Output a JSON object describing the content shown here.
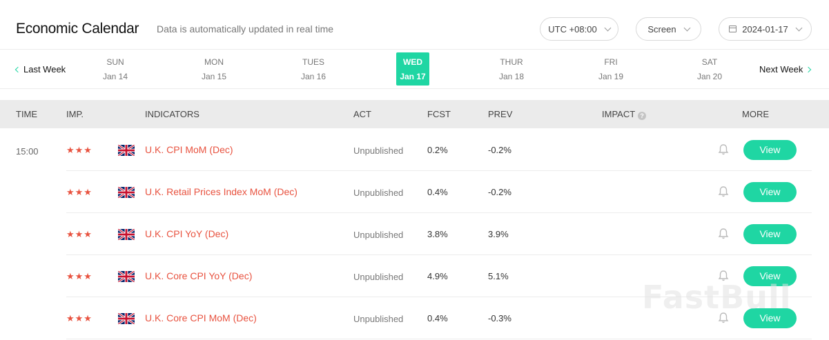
{
  "header": {
    "title": "Economic Calendar",
    "subtitle": "Data is automatically updated in real time",
    "timezone_label": "UTC +08:00",
    "view_label": "Screen",
    "date_label": "2024-01-17"
  },
  "week": {
    "prev_label": "Last Week",
    "next_label": "Next Week",
    "days": [
      {
        "name": "SUN",
        "date": "Jan 14",
        "active": false
      },
      {
        "name": "MON",
        "date": "Jan 15",
        "active": false
      },
      {
        "name": "TUES",
        "date": "Jan 16",
        "active": false
      },
      {
        "name": "WED",
        "date": "Jan 17",
        "active": true
      },
      {
        "name": "THUR",
        "date": "Jan 18",
        "active": false
      },
      {
        "name": "FRI",
        "date": "Jan 19",
        "active": false
      },
      {
        "name": "SAT",
        "date": "Jan 20",
        "active": false
      }
    ]
  },
  "table": {
    "columns": {
      "time": "TIME",
      "imp": "IMP.",
      "indicators": "INDICATORS",
      "act": "ACT",
      "fcst": "FCST",
      "prev": "PREV",
      "impact": "IMPACT",
      "more": "MORE"
    },
    "time": "15:00",
    "view_label": "View",
    "rows": [
      {
        "stars": 3,
        "country_flag": "uk-flag-icon",
        "indicator": "U.K. CPI MoM (Dec)",
        "act": "Unpublished",
        "fcst": "0.2%",
        "prev": "-0.2%"
      },
      {
        "stars": 3,
        "country_flag": "uk-flag-icon",
        "indicator": "U.K. Retail Prices Index MoM (Dec)",
        "act": "Unpublished",
        "fcst": "0.4%",
        "prev": "-0.2%"
      },
      {
        "stars": 3,
        "country_flag": "uk-flag-icon",
        "indicator": "U.K. CPI YoY (Dec)",
        "act": "Unpublished",
        "fcst": "3.8%",
        "prev": "3.9%"
      },
      {
        "stars": 3,
        "country_flag": "uk-flag-icon",
        "indicator": "U.K. Core CPI YoY (Dec)",
        "act": "Unpublished",
        "fcst": "4.9%",
        "prev": "5.1%"
      },
      {
        "stars": 3,
        "country_flag": "uk-flag-icon",
        "indicator": "U.K. Core CPI MoM (Dec)",
        "act": "Unpublished",
        "fcst": "0.4%",
        "prev": "-0.3%"
      }
    ]
  },
  "watermark": "FastBull",
  "colors": {
    "accent": "#1fd6a3",
    "indicator_red": "#e8523f",
    "header_bg": "#ebebeb"
  }
}
